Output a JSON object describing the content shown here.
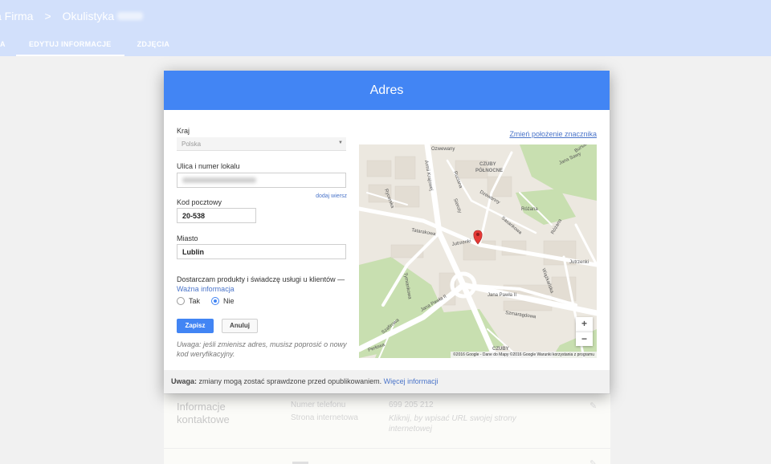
{
  "header": {
    "breadcrumb_parent": "a Firma",
    "breadcrumb_separator": ">",
    "breadcrumb_current": "Okulistyka",
    "tabs": [
      {
        "label": "A"
      },
      {
        "label": "EDYTUJ INFORMACJE"
      },
      {
        "label": "ZDJĘCIA"
      }
    ]
  },
  "background": {
    "section_title": "Informacje kontaktowe",
    "phone_label": "Numer telefonu",
    "phone_value": "699 205 212",
    "website_label": "Strona internetowa",
    "website_value": "Kliknij, by wpisać URL swojej strony internetowej"
  },
  "dialog": {
    "title": "Adres",
    "country_label": "Kraj",
    "country_value": "Polska",
    "street_label": "Ulica i numer lokalu",
    "add_line_link": "dodaj wiersz",
    "postal_label": "Kod pocztowy",
    "postal_value": "20-538",
    "city_label": "Miasto",
    "city_value": "Lublin",
    "delivery_text": "Dostarczam produkty i świadczę usługi u klientów —",
    "delivery_link": "Ważna informacja",
    "radio_yes": "Tak",
    "radio_no": "Nie",
    "save_button": "Zapisz",
    "cancel_button": "Anuluj",
    "note": "Uwaga: jeśli zmienisz adres, musisz poprosić o nowy kod weryfikacyjny.",
    "change_marker_link": "Zmień położenie znacznika",
    "map_attribution": "©2016 Google - Dane do Mapy ©2016 Google   Warunki korzystania z programu",
    "zoom_in": "+",
    "zoom_out": "−",
    "footer_bold": "Uwaga:",
    "footer_text": " zmiany mogą zostać sprawdzone przed opublikowaniem. ",
    "footer_link": "Więcej informacji"
  },
  "map_labels": {
    "l1": "Ozwewany",
    "l2": "CZUBY",
    "l3": "PÓŁNOCNE",
    "l4": "Jana Sawy",
    "l5": "Bursaki",
    "l6": "Armii Krajowej",
    "l7": "Ruciana",
    "l8": "Rycerska",
    "l9": "Sieroty",
    "l10": "Dzewanny",
    "l11": "Różana",
    "l12": "Tatarakowa",
    "l13": "Sasankowa",
    "l14": "Jutrzenki",
    "l15": "Jutrzenki",
    "l16": "Różana",
    "l17": "Tymiankowa",
    "l18": "Jana Pawła II",
    "l19": "Jana Pawła II",
    "l20": "Wiążkańska",
    "l21": "Szmaragdowa",
    "l22": "Szafirowa",
    "l23": "Perłowa",
    "l24": "CZUBY"
  },
  "colors": {
    "accent": "#4285f4",
    "header_bg": "#d2e0fb",
    "link": "#4a74c9",
    "map_park": "#c8dfb0",
    "map_road": "#ffffff",
    "marker": "#e53935"
  }
}
